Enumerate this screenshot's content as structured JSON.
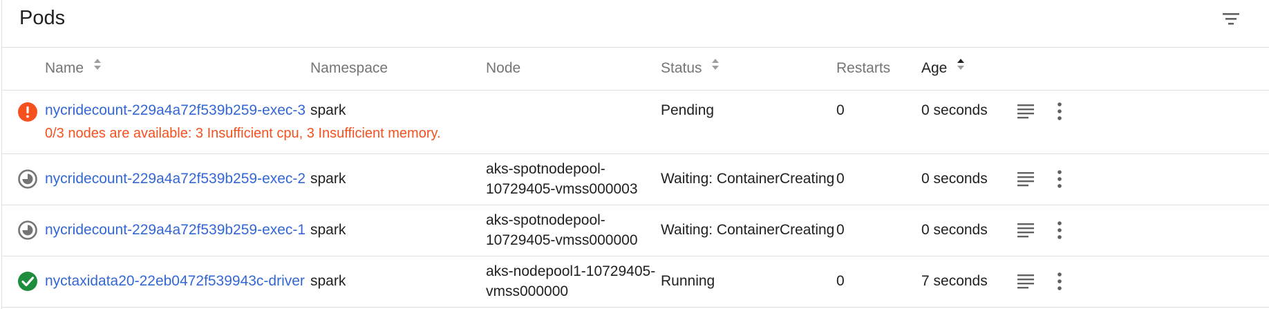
{
  "title": "Pods",
  "icons": {
    "filter": "filter-list-icon",
    "logs": "logs-icon",
    "more": "more-vert-icon",
    "sort": "sort-icon"
  },
  "colors": {
    "link": "#3367d6",
    "error": "#f4511e",
    "success": "#1e8e3e",
    "pending_icon": "#757575"
  },
  "columns": {
    "name": "Name",
    "namespace": "Namespace",
    "node": "Node",
    "status": "Status",
    "restarts": "Restarts",
    "age": "Age"
  },
  "rows": [
    {
      "state": "error",
      "name": "nycridecount-229a4a72f539b259-exec-3",
      "namespace": "spark",
      "node_line1": "",
      "node_line2": "",
      "status": "Pending",
      "restarts": "0",
      "age": "0 seconds",
      "message": "0/3 nodes are available: 3 Insufficient cpu, 3 Insufficient memory."
    },
    {
      "state": "pending",
      "name": "nycridecount-229a4a72f539b259-exec-2",
      "namespace": "spark",
      "node_line1": "aks-spotnodepool-",
      "node_line2": "10729405-vmss000003",
      "status": "Waiting: ContainerCreating",
      "restarts": "0",
      "age": "0 seconds"
    },
    {
      "state": "pending",
      "name": "nycridecount-229a4a72f539b259-exec-1",
      "namespace": "spark",
      "node_line1": "aks-spotnodepool-",
      "node_line2": "10729405-vmss000000",
      "status": "Waiting: ContainerCreating",
      "restarts": "0",
      "age": "0 seconds"
    },
    {
      "state": "running",
      "name": "nyctaxidata20-22eb0472f539943c-driver",
      "namespace": "spark",
      "node_line1": "aks-nodepool1-10729405-",
      "node_line2": "vmss000000",
      "status": "Running",
      "restarts": "0",
      "age": "7 seconds"
    }
  ]
}
